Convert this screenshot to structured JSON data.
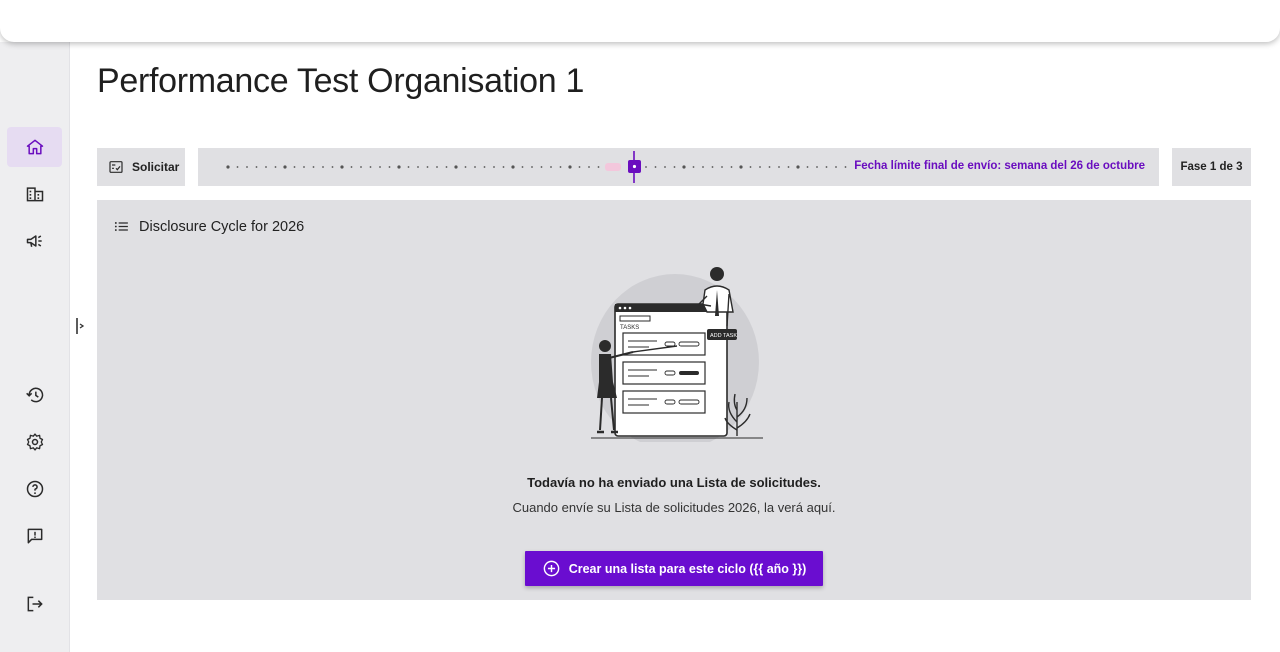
{
  "page": {
    "title": "Performance Test Organisation 1"
  },
  "sidebar": {
    "items": [
      {
        "icon": "home-icon",
        "active": true
      },
      {
        "icon": "building-icon",
        "active": false
      },
      {
        "icon": "megaphone-icon",
        "active": false
      },
      {
        "icon": "history-icon",
        "active": false
      },
      {
        "icon": "settings-gear-icon",
        "active": false
      },
      {
        "icon": "help-circle-icon",
        "active": false
      },
      {
        "icon": "feedback-icon",
        "active": false
      },
      {
        "icon": "logout-icon",
        "active": false
      }
    ]
  },
  "progress": {
    "request_label": "Solicitar",
    "deadline_text": "Fecha límite final de envío: semana del 26 de octubre",
    "phase_text": "Fase 1 de 3",
    "accent_color": "#6a0dbf"
  },
  "cycle": {
    "title": "Disclosure Cycle for 2026",
    "empty_title": "Todavía no ha enviado una Lista de solicitudes.",
    "empty_subtitle": "Cuando envíe su Lista de solicitudes 2026, la verá aquí.",
    "illustration_tasks_label": "TASKS",
    "illustration_add_task_label": "ADD TASK",
    "create_button_label": "Crear una lista para este ciclo ({{ año }})"
  }
}
